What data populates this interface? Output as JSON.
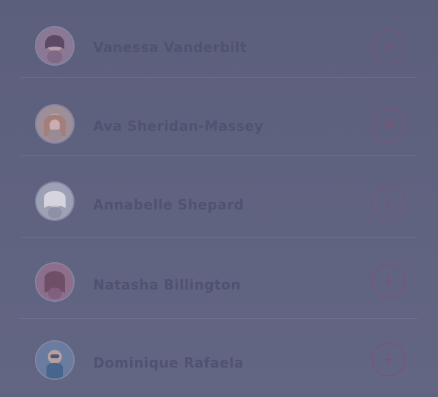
{
  "contacts": {
    "items": [
      {
        "name": "Vanessa Vanderbilt"
      },
      {
        "name": "Ava Sheridan-Massey"
      },
      {
        "name": "Annabelle Shepard"
      },
      {
        "name": "Natasha Billington"
      },
      {
        "name": "Dominique Rafaela"
      }
    ]
  },
  "colors": {
    "background": "#5f6281",
    "text": "#505271",
    "add_button": "#765676"
  },
  "icons": {
    "add": "plus-icon"
  }
}
